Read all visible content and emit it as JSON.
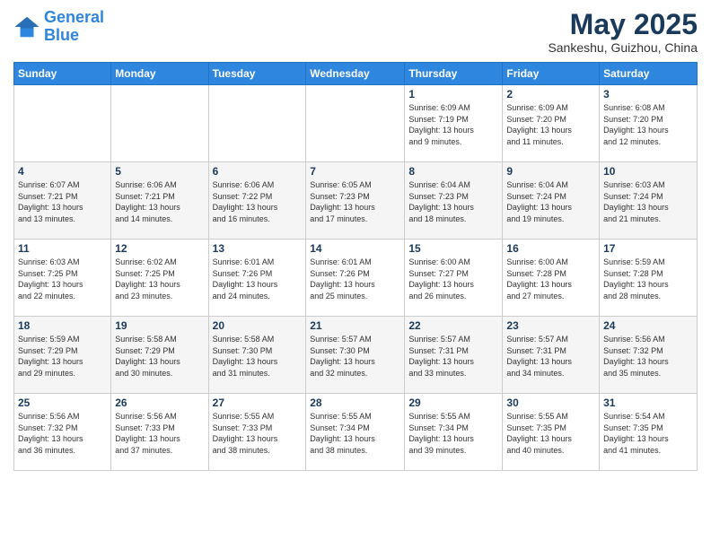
{
  "logo": {
    "line1": "General",
    "line2": "Blue"
  },
  "title": {
    "month_year": "May 2025",
    "location": "Sankeshu, Guizhou, China"
  },
  "days_of_week": [
    "Sunday",
    "Monday",
    "Tuesday",
    "Wednesday",
    "Thursday",
    "Friday",
    "Saturday"
  ],
  "weeks": [
    [
      {
        "day": "",
        "info": ""
      },
      {
        "day": "",
        "info": ""
      },
      {
        "day": "",
        "info": ""
      },
      {
        "day": "",
        "info": ""
      },
      {
        "day": "1",
        "info": "Sunrise: 6:09 AM\nSunset: 7:19 PM\nDaylight: 13 hours\nand 9 minutes."
      },
      {
        "day": "2",
        "info": "Sunrise: 6:09 AM\nSunset: 7:20 PM\nDaylight: 13 hours\nand 11 minutes."
      },
      {
        "day": "3",
        "info": "Sunrise: 6:08 AM\nSunset: 7:20 PM\nDaylight: 13 hours\nand 12 minutes."
      }
    ],
    [
      {
        "day": "4",
        "info": "Sunrise: 6:07 AM\nSunset: 7:21 PM\nDaylight: 13 hours\nand 13 minutes."
      },
      {
        "day": "5",
        "info": "Sunrise: 6:06 AM\nSunset: 7:21 PM\nDaylight: 13 hours\nand 14 minutes."
      },
      {
        "day": "6",
        "info": "Sunrise: 6:06 AM\nSunset: 7:22 PM\nDaylight: 13 hours\nand 16 minutes."
      },
      {
        "day": "7",
        "info": "Sunrise: 6:05 AM\nSunset: 7:23 PM\nDaylight: 13 hours\nand 17 minutes."
      },
      {
        "day": "8",
        "info": "Sunrise: 6:04 AM\nSunset: 7:23 PM\nDaylight: 13 hours\nand 18 minutes."
      },
      {
        "day": "9",
        "info": "Sunrise: 6:04 AM\nSunset: 7:24 PM\nDaylight: 13 hours\nand 19 minutes."
      },
      {
        "day": "10",
        "info": "Sunrise: 6:03 AM\nSunset: 7:24 PM\nDaylight: 13 hours\nand 21 minutes."
      }
    ],
    [
      {
        "day": "11",
        "info": "Sunrise: 6:03 AM\nSunset: 7:25 PM\nDaylight: 13 hours\nand 22 minutes."
      },
      {
        "day": "12",
        "info": "Sunrise: 6:02 AM\nSunset: 7:25 PM\nDaylight: 13 hours\nand 23 minutes."
      },
      {
        "day": "13",
        "info": "Sunrise: 6:01 AM\nSunset: 7:26 PM\nDaylight: 13 hours\nand 24 minutes."
      },
      {
        "day": "14",
        "info": "Sunrise: 6:01 AM\nSunset: 7:26 PM\nDaylight: 13 hours\nand 25 minutes."
      },
      {
        "day": "15",
        "info": "Sunrise: 6:00 AM\nSunset: 7:27 PM\nDaylight: 13 hours\nand 26 minutes."
      },
      {
        "day": "16",
        "info": "Sunrise: 6:00 AM\nSunset: 7:28 PM\nDaylight: 13 hours\nand 27 minutes."
      },
      {
        "day": "17",
        "info": "Sunrise: 5:59 AM\nSunset: 7:28 PM\nDaylight: 13 hours\nand 28 minutes."
      }
    ],
    [
      {
        "day": "18",
        "info": "Sunrise: 5:59 AM\nSunset: 7:29 PM\nDaylight: 13 hours\nand 29 minutes."
      },
      {
        "day": "19",
        "info": "Sunrise: 5:58 AM\nSunset: 7:29 PM\nDaylight: 13 hours\nand 30 minutes."
      },
      {
        "day": "20",
        "info": "Sunrise: 5:58 AM\nSunset: 7:30 PM\nDaylight: 13 hours\nand 31 minutes."
      },
      {
        "day": "21",
        "info": "Sunrise: 5:57 AM\nSunset: 7:30 PM\nDaylight: 13 hours\nand 32 minutes."
      },
      {
        "day": "22",
        "info": "Sunrise: 5:57 AM\nSunset: 7:31 PM\nDaylight: 13 hours\nand 33 minutes."
      },
      {
        "day": "23",
        "info": "Sunrise: 5:57 AM\nSunset: 7:31 PM\nDaylight: 13 hours\nand 34 minutes."
      },
      {
        "day": "24",
        "info": "Sunrise: 5:56 AM\nSunset: 7:32 PM\nDaylight: 13 hours\nand 35 minutes."
      }
    ],
    [
      {
        "day": "25",
        "info": "Sunrise: 5:56 AM\nSunset: 7:32 PM\nDaylight: 13 hours\nand 36 minutes."
      },
      {
        "day": "26",
        "info": "Sunrise: 5:56 AM\nSunset: 7:33 PM\nDaylight: 13 hours\nand 37 minutes."
      },
      {
        "day": "27",
        "info": "Sunrise: 5:55 AM\nSunset: 7:33 PM\nDaylight: 13 hours\nand 38 minutes."
      },
      {
        "day": "28",
        "info": "Sunrise: 5:55 AM\nSunset: 7:34 PM\nDaylight: 13 hours\nand 38 minutes."
      },
      {
        "day": "29",
        "info": "Sunrise: 5:55 AM\nSunset: 7:34 PM\nDaylight: 13 hours\nand 39 minutes."
      },
      {
        "day": "30",
        "info": "Sunrise: 5:55 AM\nSunset: 7:35 PM\nDaylight: 13 hours\nand 40 minutes."
      },
      {
        "day": "31",
        "info": "Sunrise: 5:54 AM\nSunset: 7:35 PM\nDaylight: 13 hours\nand 41 minutes."
      }
    ]
  ]
}
